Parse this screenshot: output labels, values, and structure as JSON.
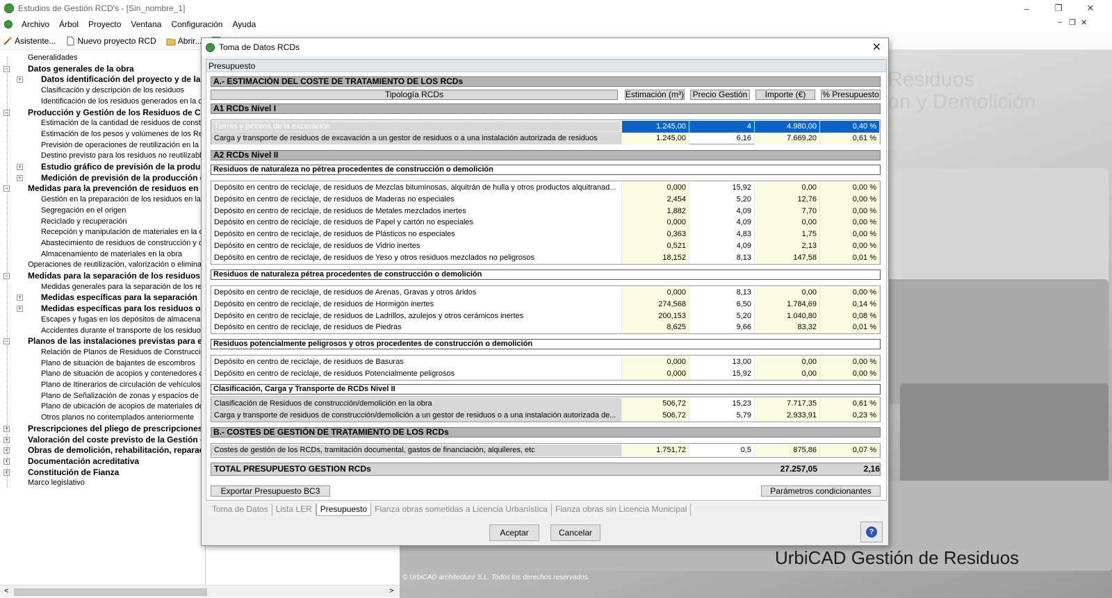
{
  "window": {
    "title": "Estudios de Gestión RCD's - [Sin_nombre_1]",
    "controls": [
      "–",
      "❐",
      "✕"
    ]
  },
  "menu": {
    "items": [
      "Archivo",
      "Árbol",
      "Proyecto",
      "Ventana",
      "Configuración",
      "Ayuda"
    ],
    "mdi": [
      "–",
      "❐",
      "✕"
    ]
  },
  "toolbar": {
    "asistente": "Asistente...",
    "nuevo": "Nuevo proyecto RCD",
    "abrir": "Abrir..."
  },
  "tree": {
    "nodes": [
      {
        "label": "Generalidades",
        "bold": false,
        "level": 1,
        "exp": ""
      },
      {
        "label": "Datos generales de la obra",
        "bold": true,
        "level": 1,
        "exp": "-"
      },
      {
        "label": "Datos identificación del proyecto y de la",
        "bold": true,
        "level": 2,
        "exp": "+"
      },
      {
        "label": "Clasificación y descripción de los residuos",
        "bold": false,
        "level": 2,
        "exp": ""
      },
      {
        "label": "Identificación de los residuos generados en la obra",
        "bold": false,
        "level": 2,
        "exp": ""
      },
      {
        "label": "Producción y Gestión de los Residuos de Co",
        "bold": true,
        "level": 1,
        "exp": "-"
      },
      {
        "label": "Estimación de la cantidad de residuos de construcción",
        "bold": false,
        "level": 2,
        "exp": ""
      },
      {
        "label": "Estimación de los pesos y volúmenes de los Resid",
        "bold": false,
        "level": 2,
        "exp": ""
      },
      {
        "label": "Previsión de operaciones de reutilización en la mis",
        "bold": false,
        "level": 2,
        "exp": ""
      },
      {
        "label": "Destino previsto para los residuos no reutilizables",
        "bold": false,
        "level": 2,
        "exp": ""
      },
      {
        "label": "Estudio gráfico de previsión de la producc",
        "bold": true,
        "level": 2,
        "exp": "+"
      },
      {
        "label": "Medición de previsión de la producción d",
        "bold": true,
        "level": 2,
        "exp": "+"
      },
      {
        "label": "Medidas para la prevención de residuos en l",
        "bold": true,
        "level": 1,
        "exp": "-"
      },
      {
        "label": "Gestión en la preparación de los residuos en la ob",
        "bold": false,
        "level": 2,
        "exp": ""
      },
      {
        "label": "Segregación en el origen",
        "bold": false,
        "level": 2,
        "exp": ""
      },
      {
        "label": "Reciclado y recuperación",
        "bold": false,
        "level": 2,
        "exp": ""
      },
      {
        "label": "Recepción y manipulación de materiales en la obr",
        "bold": false,
        "level": 2,
        "exp": ""
      },
      {
        "label": "Abastecimiento de residuos de construcción y den",
        "bold": false,
        "level": 2,
        "exp": ""
      },
      {
        "label": "Almacenamiento de materiales en la obra",
        "bold": false,
        "level": 2,
        "exp": ""
      },
      {
        "label": "Operaciones de reutilización, valorización o eliminació",
        "bold": false,
        "level": 1,
        "exp": ""
      },
      {
        "label": "Medidas para la separación de los residuos",
        "bold": true,
        "level": 1,
        "exp": "-"
      },
      {
        "label": "Medidas generales para la separación de los resid",
        "bold": false,
        "level": 2,
        "exp": ""
      },
      {
        "label": "Medidas específicas para la separación",
        "bold": true,
        "level": 2,
        "exp": "+"
      },
      {
        "label": "Medidas específicas para los residuos oc",
        "bold": true,
        "level": 2,
        "exp": "+"
      },
      {
        "label": "Escapes y fugas en los depósitos de almacenamie",
        "bold": false,
        "level": 2,
        "exp": ""
      },
      {
        "label": "Accidentes durante el transporte de los residuos a",
        "bold": false,
        "level": 2,
        "exp": ""
      },
      {
        "label": "Planos de las instalaciones previstas para el",
        "bold": true,
        "level": 1,
        "exp": "-"
      },
      {
        "label": "Relación de Planos de Residuos de Construcción",
        "bold": false,
        "level": 2,
        "exp": ""
      },
      {
        "label": "Plano de situación de bajantes de escombros",
        "bold": false,
        "level": 2,
        "exp": ""
      },
      {
        "label": "Plano de situación de acopios y contenedores de",
        "bold": false,
        "level": 2,
        "exp": ""
      },
      {
        "label": "Plano de Itinerarios de circulación de vehículos p",
        "bold": false,
        "level": 2,
        "exp": ""
      },
      {
        "label": "Plano de Señalización de zonas y espacios de RC",
        "bold": false,
        "level": 2,
        "exp": ""
      },
      {
        "label": "Plano de ubicación de acopios de materiales de re",
        "bold": false,
        "level": 2,
        "exp": ""
      },
      {
        "label": "Otros planos no contemplados anteriormente",
        "bold": false,
        "level": 2,
        "exp": ""
      },
      {
        "label": "Prescripciones del pliego de prescripciones t",
        "bold": true,
        "level": 1,
        "exp": "+"
      },
      {
        "label": "Valoración del coste previsto de la Gestión c",
        "bold": true,
        "level": 1,
        "exp": "+"
      },
      {
        "label": "Obras de demolición, rehabilitación, reparaci",
        "bold": true,
        "level": 1,
        "exp": "+"
      },
      {
        "label": "Documentación acreditativa",
        "bold": true,
        "level": 1,
        "exp": "+"
      },
      {
        "label": "Constitución de Fianza",
        "bold": true,
        "level": 1,
        "exp": "+"
      },
      {
        "label": "Marco legislativo",
        "bold": false,
        "level": 1,
        "exp": ""
      }
    ]
  },
  "background": {
    "wm1": "Residuos",
    "wm2": "on y Demolición",
    "brand": "UrbiCAD Gestión de Residuos",
    "copyright": "© UrbiCAD architecture S.L. Todos los derechos reservados."
  },
  "dialog": {
    "title": "Toma de Datos RCDs",
    "panel_header": "Presupuesto",
    "secA": "A.- ESTIMACIÓN DEL COSTE DE TRATAMIENTO DE LOS RCDs",
    "cols": {
      "tipologia": "Tipología RCDs",
      "estimacion": "Estimación (m³)",
      "precio": "Precio Gestión",
      "importe": "Importe (€)",
      "pct": "% Presupuesto"
    },
    "nivel1": "A1 RCDs Nivel I",
    "nivel1_rows": [
      {
        "d": "Tierras y pétreos de la excavación",
        "v": [
          "1.245,00",
          "4",
          "4.980,00",
          "0,40 %"
        ]
      },
      {
        "d": "Carga y transporte de residuos de excavación a un gestor de residuos o a una instalación autorizada de residuos",
        "v": [
          "1.245,00",
          "6,16",
          "7.669,20",
          "0,61 %"
        ]
      }
    ],
    "nivel2": "A2 RCDs Nivel II",
    "g1_title": "Residuos de naturaleza no pétrea procedentes de construcción o demolición",
    "g1_rows": [
      {
        "d": "Depósito en centro de reciclaje, de residuos de Mezclas bituminosas, alquitrán de hulla y otros productos alquitranad...",
        "v": [
          "0,000",
          "15,92",
          "0,00",
          "0,00 %"
        ]
      },
      {
        "d": "Depósito en centro de reciclaje, de residuos de Maderas no especiales",
        "v": [
          "2,454",
          "5,20",
          "12,76",
          "0,00 %"
        ]
      },
      {
        "d": "Depósito en centro de reciclaje, de residuos de Metales mezclados inertes",
        "v": [
          "1,882",
          "4,09",
          "7,70",
          "0,00 %"
        ]
      },
      {
        "d": "Depósito en centro de reciclaje, de residuos de Papel y cartón no especiales",
        "v": [
          "0,000",
          "4,09",
          "0,00",
          "0,00 %"
        ]
      },
      {
        "d": "Depósito en centro de reciclaje, de residuos de Plásticos no especiales",
        "v": [
          "0,363",
          "4,83",
          "1,75",
          "0,00 %"
        ]
      },
      {
        "d": "Depósito en centro de reciclaje, de residuos de Vidrio inertes",
        "v": [
          "0,521",
          "4,09",
          "2,13",
          "0,00 %"
        ]
      },
      {
        "d": "Depósito en centro de reciclaje, de residuos de Yeso y otros residuos mezclados no peligrosos",
        "v": [
          "18,152",
          "8,13",
          "147,58",
          "0,01 %"
        ]
      }
    ],
    "g2_title": "Residuos de naturaleza pétrea procedentes de construcción o demolición",
    "g2_rows": [
      {
        "d": "Depósito en centro de reciclaje, de residuos de Arenas, Gravas y otros áridos",
        "v": [
          "0,000",
          "8,13",
          "0,00",
          "0,00 %"
        ]
      },
      {
        "d": "Depósito en centro de reciclaje, de residuos de Hormigón inertes",
        "v": [
          "274,568",
          "6,50",
          "1.784,69",
          "0,14 %"
        ]
      },
      {
        "d": "Depósito en centro de reciclaje, de residuos de Ladrillos, azulejos y otros cerámicos inertes",
        "v": [
          "200,153",
          "5,20",
          "1.040,80",
          "0,08 %"
        ]
      },
      {
        "d": "Depósito en centro de reciclaje, de residuos de Piedras",
        "v": [
          "8,625",
          "9,66",
          "83,32",
          "0,01 %"
        ]
      }
    ],
    "g3_title": "Residuos potencialmente peligrosos y otros procedentes de construcción o demolición",
    "g3_rows": [
      {
        "d": "Depósito en centro de reciclaje, de residuos de Basuras",
        "v": [
          "0,000",
          "13,00",
          "0,00",
          "0,00 %"
        ]
      },
      {
        "d": "Depósito en centro de reciclaje, de residuos Potencialmente peligrosos",
        "v": [
          "0,000",
          "15,92",
          "0,00",
          "0,00 %"
        ]
      }
    ],
    "g4_title": "Clasificación, Carga y Transporte de RCDs Nivel II",
    "g4_rows": [
      {
        "d": "Clasificación de Residuos de construcción/demolición en la obra",
        "v": [
          "506,72",
          "15,23",
          "7.717,35",
          "0,61 %"
        ]
      },
      {
        "d": "Carga y transporte de residuos de construcción/demolición a un gestor de residuos o a una instalación autorizada de...",
        "v": [
          "506,72",
          "5,79",
          "2.933,91",
          "0,23 %"
        ]
      }
    ],
    "secB": "B.- COSTES DE GESTIÓN DE TRATAMIENTO DE LOS RCDs",
    "b_rows": [
      {
        "d": "Costes de gestión de los RCDs, tramitación documental, gastos de financiación, alquileres, etc",
        "v": [
          "1.751,72",
          "0,5",
          "875,86",
          "0,07 %"
        ]
      }
    ],
    "total": {
      "label": "TOTAL PRESUPUESTO GESTION RCDs",
      "importe": "27.257,05",
      "pct": "2,16"
    },
    "btn_export": "Exportar Presupuesto BC3",
    "btn_params": "Parámetros condicionantes",
    "tabs": [
      "Toma de Datos",
      "Lista LER",
      "Presupuesto",
      "Fianza obras sometidas a Licencia Urbanística",
      "Fianza obras sin Licencia Municipal"
    ],
    "active_tab": "Presupuesto",
    "btn_ok": "Aceptar",
    "btn_cancel": "Cancelar"
  },
  "colors": {
    "selection": "#0a64c8",
    "yellow_cell": "#fbfbe0",
    "section_bar": "#b4b4b4"
  }
}
